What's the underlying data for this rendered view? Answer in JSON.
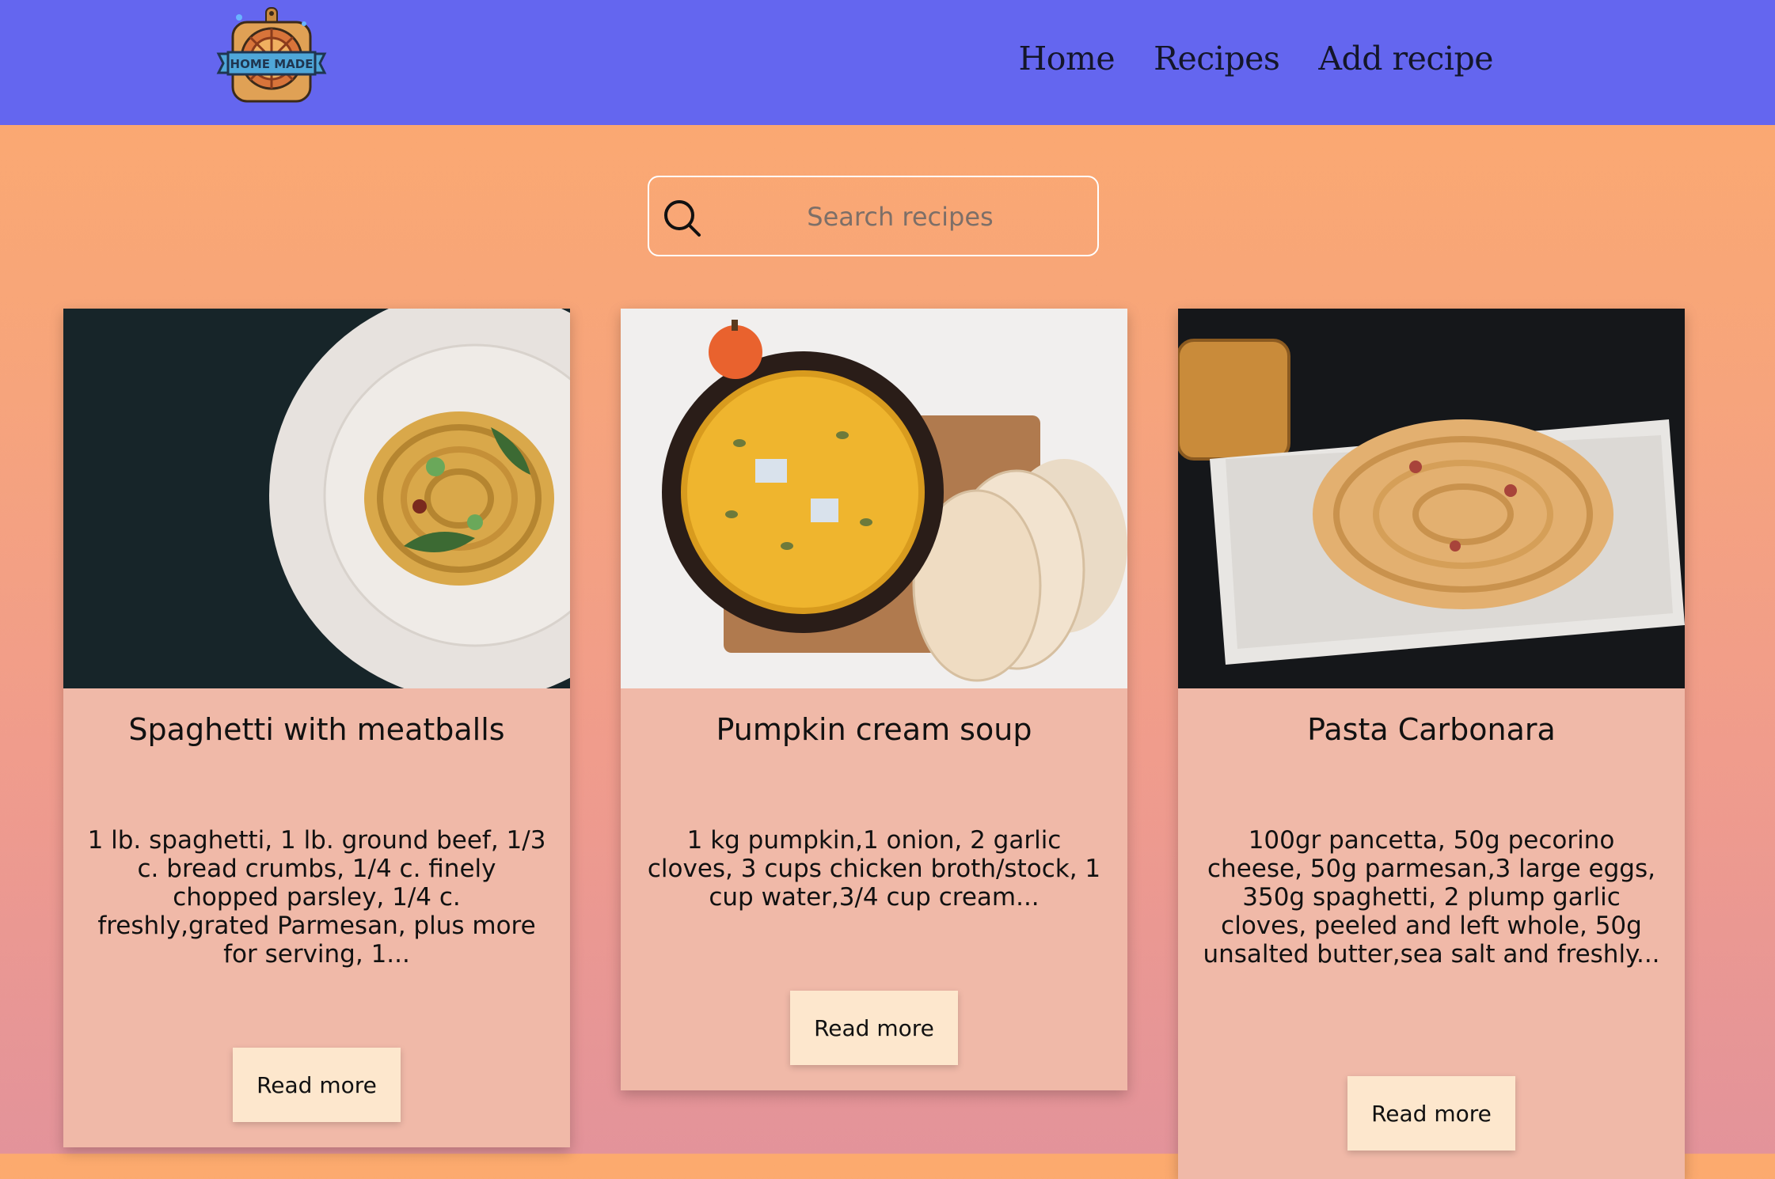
{
  "nav": {
    "logo_text": "HOME MADE",
    "links": [
      "Home",
      "Recipes",
      "Add recipe"
    ]
  },
  "search": {
    "placeholder": "Search recipes",
    "icon": "search-icon"
  },
  "recipes": [
    {
      "title": "Spaghetti with meatballs",
      "description": "1 lb. spaghetti, 1 lb. ground beef, 1/3 c. bread crumbs, 1/4 c. finely chopped parsley, 1/4 c. freshly,grated Parmesan, plus more for serving, 1...",
      "button": "Read more",
      "image": "spaghetti-plate-photo"
    },
    {
      "title": "Pumpkin cream soup",
      "description": "1 kg pumpkin,1 onion, 2 garlic cloves, 3 cups chicken broth/stock, 1 cup water,3/4 cup cream...",
      "button": "Read more",
      "image": "pumpkin-soup-photo"
    },
    {
      "title": "Pasta Carbonara",
      "description": "100gr pancetta, 50g pecorino cheese, 50g parmesan,3 large eggs, 350g spaghetti, 2 plump garlic cloves, peeled and left whole, 50g unsalted butter,sea salt and freshly...",
      "button": "Read more",
      "image": "carbonara-plate-photo"
    }
  ],
  "colors": {
    "navbar": "#6466ef",
    "background_top": "#fcaa6e",
    "background_bottom": "#e3939a",
    "card": "#f0b9a8",
    "button": "#fde7cd"
  }
}
